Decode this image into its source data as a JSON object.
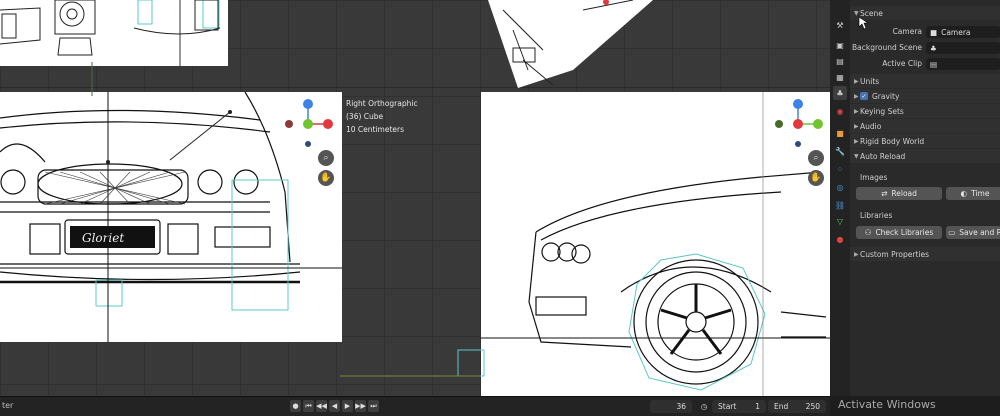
{
  "viewport": {
    "view_name": "Right Orthographic",
    "object": "(36) Cube",
    "scale": "10 Centimeters",
    "ref_text": "Gloriet"
  },
  "timeline": {
    "left_label": "ter",
    "current_frame": "36",
    "start_label": "Start",
    "start_value": "1",
    "end_label": "End",
    "end_value": "250"
  },
  "properties": {
    "scene_panel": {
      "title": "Scene",
      "camera_label": "Camera",
      "camera_value": "Camera",
      "background_scene_label": "Background Scene",
      "active_clip_label": "Active Clip"
    },
    "panels": {
      "units": "Units",
      "gravity": "Gravity",
      "keying_sets": "Keying Sets",
      "audio": "Audio",
      "rigid_body_world": "Rigid Body World",
      "auto_reload": "Auto Reload",
      "custom_properties": "Custom Properties"
    },
    "images": {
      "title": "Images",
      "reload_button": "Reload",
      "time_button": "Time"
    },
    "libraries": {
      "title": "Libraries",
      "check_button": "Check Libraries",
      "save_button": "Save and R"
    }
  },
  "watermark": "Activate Windows",
  "colors": {
    "gizmo_x": "#e0393e",
    "gizmo_y": "#6ec52e",
    "gizmo_z": "#3d83e6",
    "accent": "#4772b3"
  }
}
